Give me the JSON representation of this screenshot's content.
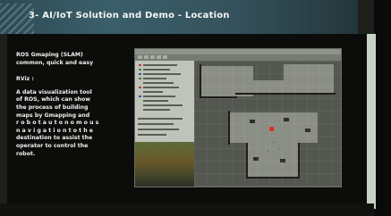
{
  "slide": {
    "title": "3- AI/IoT Solution  and Demo - Location",
    "heading_line1": "ROS Gmaping (SLAM)",
    "heading_line2": "common, quick and easy",
    "rviz_label": "RViz :",
    "description": [
      "A data visualization tool",
      "of ROS, which can show",
      "the process of building",
      "maps by Gmapping and",
      "r o b o t   a u t o n o m o u s",
      "n a v i g a t i o n   t o   t h e",
      "destination to assist the",
      "operator to control the",
      "robot."
    ]
  },
  "colors": {
    "title_bar": "#3a5f6a",
    "slide_bg": "#0c0d0b",
    "robot_marker": "#e02c20",
    "side_strip": "#c7d2c4"
  },
  "icons": [
    "robot-marker-icon"
  ]
}
